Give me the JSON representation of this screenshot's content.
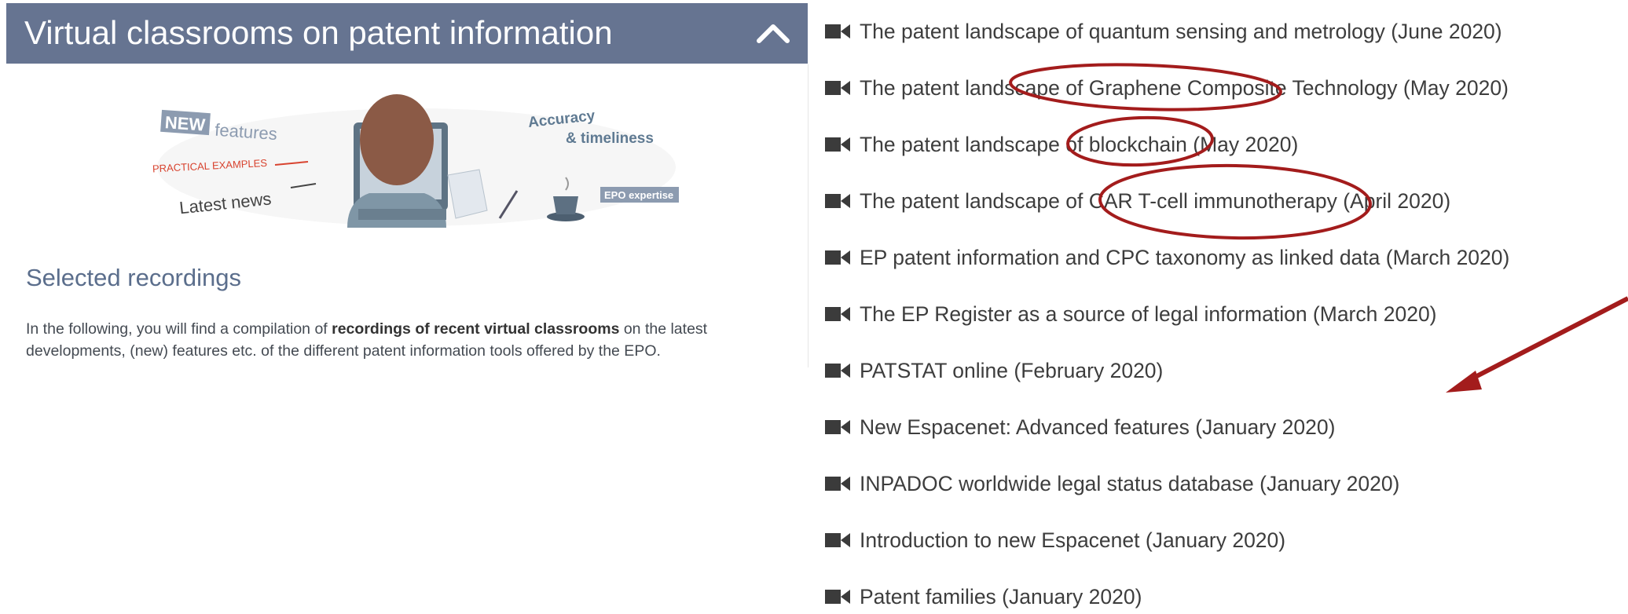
{
  "panel": {
    "title": "Virtual classrooms on patent information",
    "collapse_icon": "chevron-up-icon",
    "header_color": "#667491"
  },
  "banner": {
    "new_label": "NEW",
    "features_label": "features",
    "practical_label": "PRACTICAL EXAMPLES",
    "news_label": "Latest news",
    "accuracy_label": "Accuracy",
    "timeliness_label": "& timeliness",
    "expertise_label": "EPO expertise"
  },
  "section": {
    "title": "Selected recordings",
    "intro_before": "In the following, you will find a compilation of ",
    "intro_bold": "recordings of recent virtual classrooms",
    "intro_after": " on the latest developments, (new) features etc. of the different patent information tools offered by the EPO."
  },
  "recordings": [
    {
      "label": "The patent landscape of quantum sensing and metrology (June 2020)"
    },
    {
      "label": "The patent landscape of Graphene Composite Technology (May 2020)"
    },
    {
      "label": "The patent landscape of blockchain (May 2020)"
    },
    {
      "label": "The patent landscape of CAR T-cell immunotherapy (April 2020)"
    },
    {
      "label": "EP patent information and CPC taxonomy as linked data (March 2020)"
    },
    {
      "label": "The EP Register as a source of legal information (March 2020)"
    },
    {
      "label": "PATSTAT online (February 2020)"
    },
    {
      "label": "New Espacenet: Advanced features (January 2020)"
    },
    {
      "label": "INPADOC worldwide legal status database (January 2020)"
    },
    {
      "label": "Introduction to new Espacenet (January 2020)"
    },
    {
      "label": "Patent families (January 2020)"
    }
  ],
  "annotation": {
    "color": "#a31c1c",
    "icon": "video-camera-icon"
  }
}
